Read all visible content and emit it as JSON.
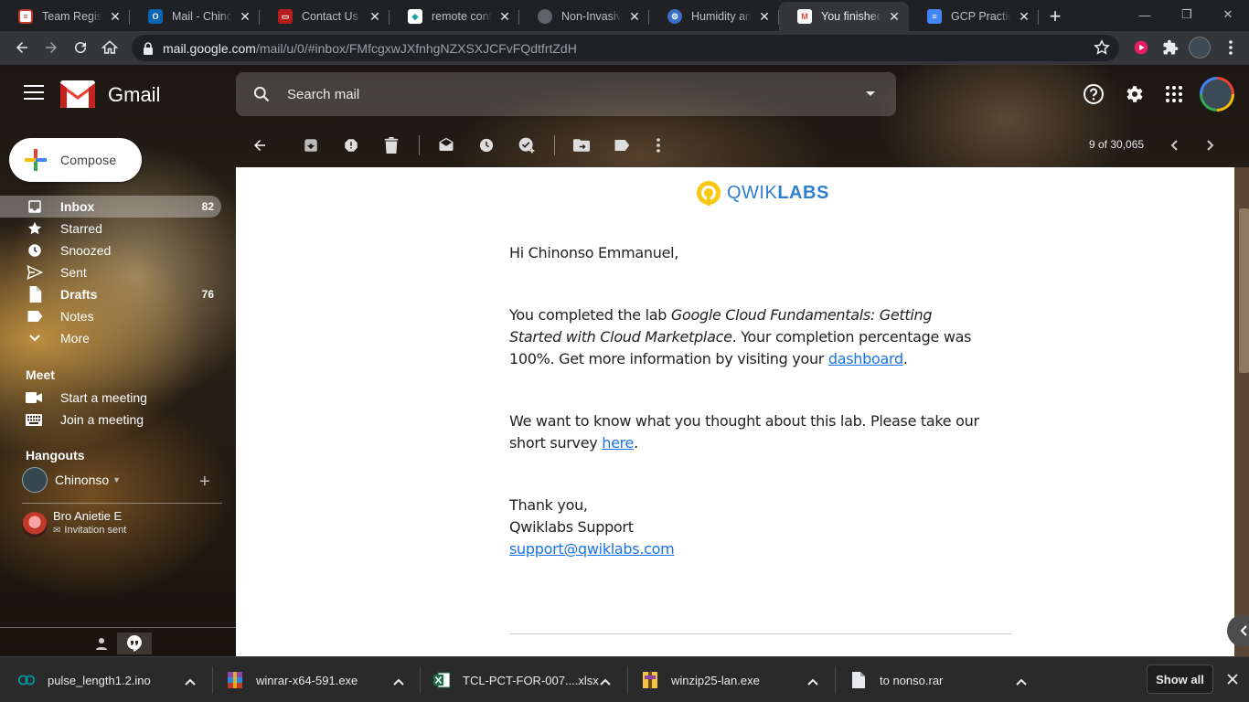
{
  "browser": {
    "tabs": [
      {
        "title": "Team Registrat",
        "icon": "form-icon",
        "color": "#c0392b"
      },
      {
        "title": "Mail - Chinonso",
        "icon": "outlook-icon",
        "color": "#0a64b4"
      },
      {
        "title": "Contact Us For",
        "icon": "site-icon",
        "color": "#b71c1c"
      },
      {
        "title": "remote control",
        "icon": "site-icon",
        "color": "#26a69a"
      },
      {
        "title": "Non-Invasive S",
        "icon": "globe-icon",
        "color": "#5f6368"
      },
      {
        "title": "Humidity and T",
        "icon": "gear-site-icon",
        "color": "#3b6cc7"
      },
      {
        "title": "You finished a",
        "icon": "gmail-icon",
        "color": "#ea4335"
      },
      {
        "title": "GCP Practice P",
        "icon": "docs-icon",
        "color": "#4285f4"
      }
    ],
    "url_host": "mail.google.com",
    "url_path": "/mail/u/0/#inbox/FMfcgxwJXfnhgNZXSXJCFvFQdtfrtZdH"
  },
  "gmail": {
    "logo_text": "Gmail",
    "search_placeholder": "Search mail",
    "compose_label": "Compose",
    "nav": [
      {
        "label": "Inbox",
        "count": "82",
        "icon": "inbox-icon",
        "active": true
      },
      {
        "label": "Starred",
        "count": "",
        "icon": "star-icon"
      },
      {
        "label": "Snoozed",
        "count": "",
        "icon": "clock-icon"
      },
      {
        "label": "Sent",
        "count": "",
        "icon": "send-icon"
      },
      {
        "label": "Drafts",
        "count": "76",
        "icon": "draft-icon",
        "bold": true
      },
      {
        "label": "Notes",
        "count": "",
        "icon": "label-icon"
      },
      {
        "label": "More",
        "count": "",
        "icon": "chevron-down-icon"
      }
    ],
    "meet": {
      "title": "Meet",
      "start": "Start a meeting",
      "join": "Join a meeting"
    },
    "hangouts": {
      "title": "Hangouts",
      "user": "Chinonso",
      "contact_name": "Bro Anietie E",
      "contact_status": "Invitation sent"
    },
    "pager": "9 of 30,065"
  },
  "email": {
    "logo_plain": "QWIK",
    "logo_bold": "LABS",
    "greeting": "Hi Chinonso Emmanuel,",
    "p1_pre": "You completed the lab ",
    "p1_lab": "Google Cloud Fundamentals: Getting Started with Cloud Marketplace",
    "p1_post": ". Your completion percentage was 100%. Get more information by visiting your ",
    "p1_link": "dashboard",
    "p1_end": ".",
    "p2_pre": "We want to know what you thought about this lab. Please take our short survey ",
    "p2_link": "here",
    "p2_end": ".",
    "sign_thanks": "Thank you,",
    "sign_team": "Qwiklabs Support",
    "sign_email": "support@qwiklabs.com"
  },
  "downloads": {
    "items": [
      {
        "name": "pulse_length1.2.ino",
        "icon": "arduino-icon"
      },
      {
        "name": "winrar-x64-591.exe",
        "icon": "winrar-icon"
      },
      {
        "name": "TCL-PCT-FOR-007....xlsx",
        "icon": "excel-icon"
      },
      {
        "name": "winzip25-lan.exe",
        "icon": "winzip-icon"
      },
      {
        "name": "to nonso.rar",
        "icon": "file-icon"
      }
    ],
    "show_all": "Show all"
  }
}
